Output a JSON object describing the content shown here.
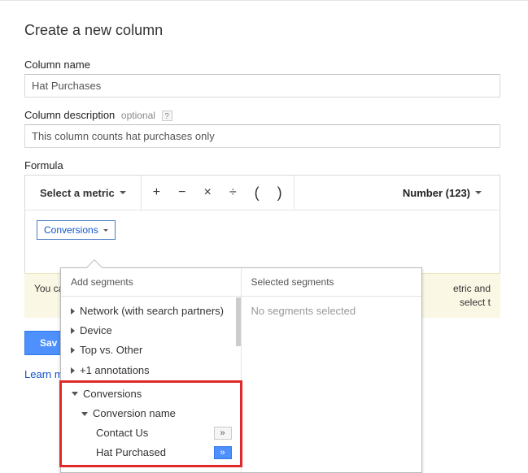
{
  "title": "Create a new column",
  "columnName": {
    "label": "Column name",
    "value": "Hat Purchases"
  },
  "columnDesc": {
    "label": "Column description",
    "optional": "optional",
    "help": "?",
    "value": "This column counts hat purchases only"
  },
  "formula": {
    "label": "Formula",
    "metricLabel": "Select a metric",
    "operators": {
      "plus": "+",
      "minus": "−",
      "mult": "×",
      "div": "÷",
      "lparen": "(",
      "rparen": ")"
    },
    "formatLabel": "Number (123)",
    "chip": "Conversions"
  },
  "hint": {
    "left": "You ca",
    "right": "etric and\nselect t"
  },
  "saveLabel": "Sav",
  "learnLabel": "Learn m",
  "popover": {
    "addHeader": "Add segments",
    "selHeader": "Selected segments",
    "selEmpty": "No segments selected",
    "items": {
      "network": "Network (with search partners)",
      "device": "Device",
      "topOther": "Top vs. Other",
      "plus1": "+1 annotations",
      "conversions": "Conversions",
      "convName": "Conversion name",
      "contactUs": "Contact Us",
      "hatPurchased": "Hat Purchased"
    },
    "addGlyph": "»"
  }
}
